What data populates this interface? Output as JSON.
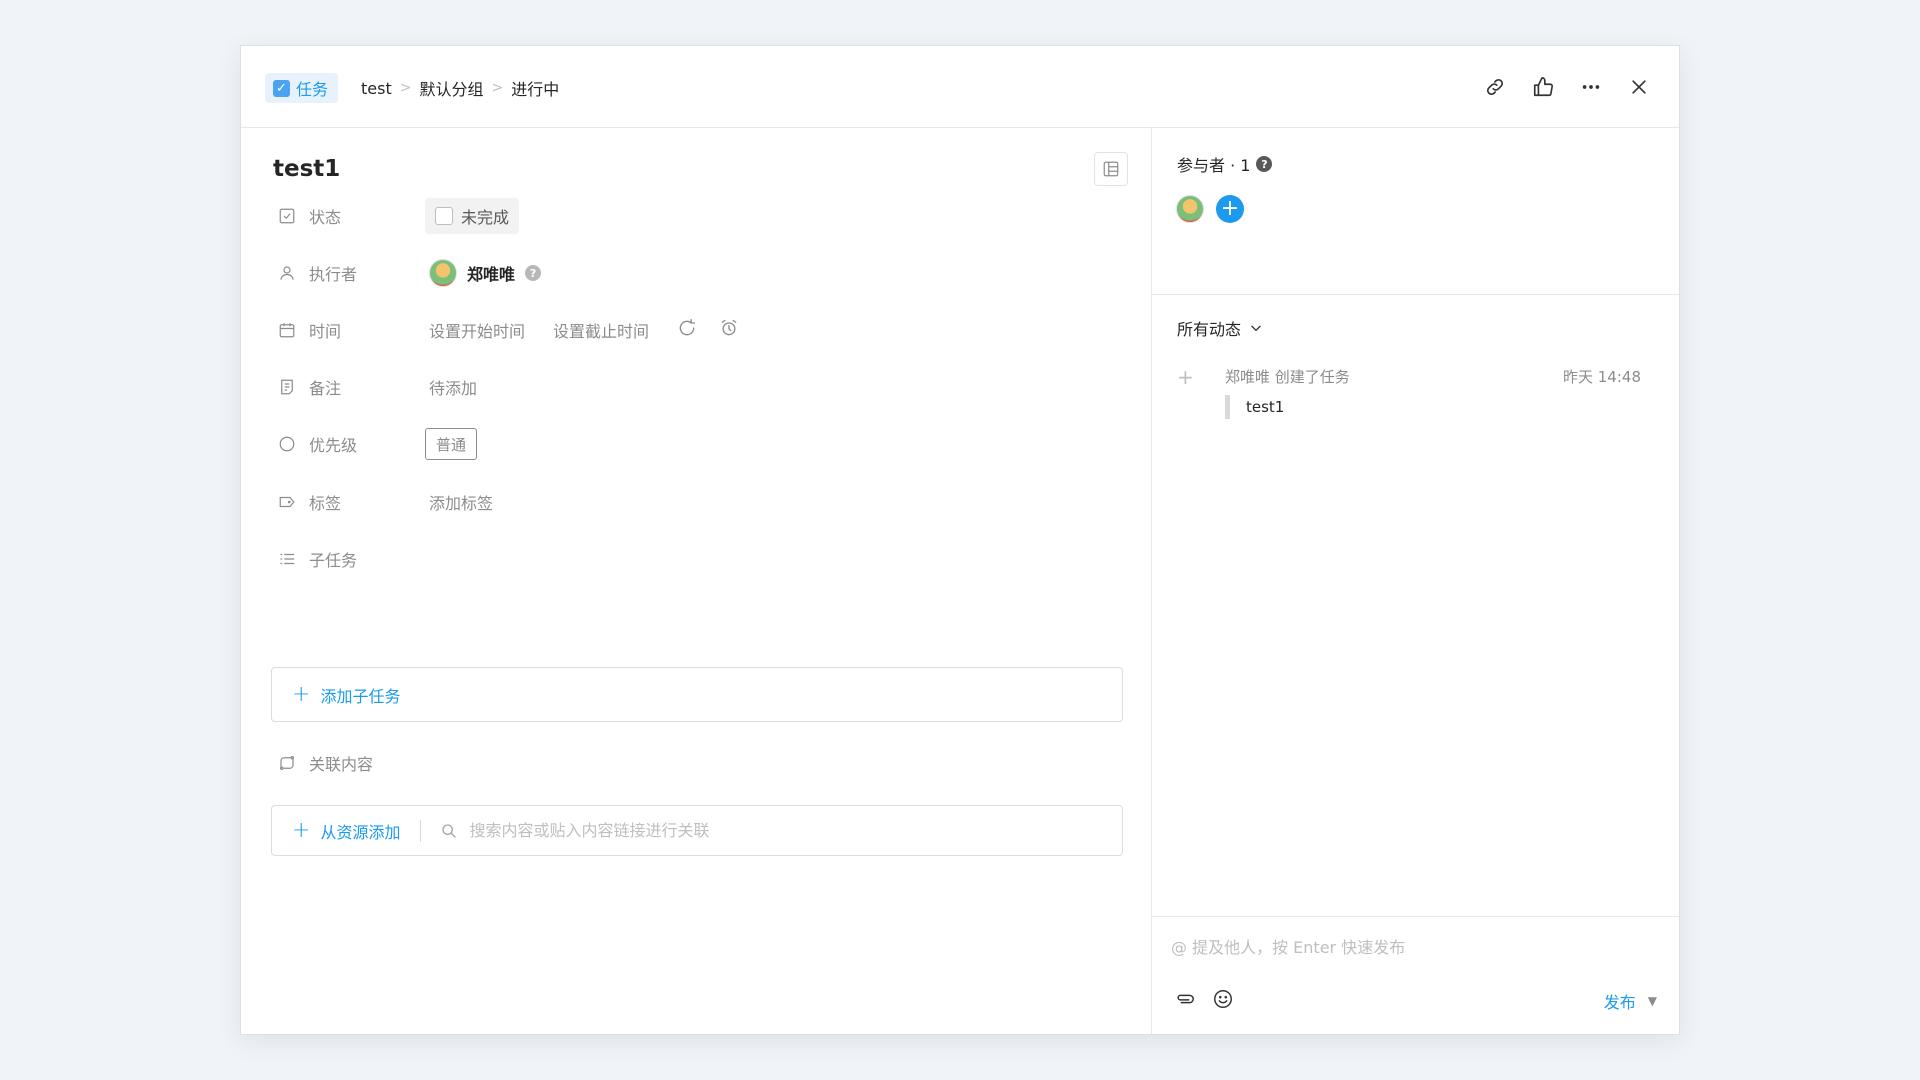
{
  "header": {
    "type_label": "任务",
    "breadcrumbs": [
      "test",
      "默认分组",
      "进行中"
    ]
  },
  "task": {
    "title": "test1",
    "fields": {
      "status": {
        "label": "状态",
        "value": "未完成"
      },
      "executor": {
        "label": "执行者",
        "value": "郑唯唯"
      },
      "time": {
        "label": "时间",
        "start": "设置开始时间",
        "due": "设置截止时间"
      },
      "note": {
        "label": "备注",
        "value": "待添加"
      },
      "priority": {
        "label": "优先级",
        "value": "普通"
      },
      "tags": {
        "label": "标签",
        "value": "添加标签"
      },
      "subtasks": {
        "label": "子任务"
      }
    },
    "add_subtask_label": "添加子任务",
    "related": {
      "label": "关联内容",
      "add_label": "从资源添加",
      "search_placeholder": "搜索内容或贴入内容链接进行关联"
    }
  },
  "sidebar": {
    "participants_label": "参与者 · 1",
    "activity_filter": "所有动态",
    "activities": [
      {
        "text": "郑唯唯 创建了任务",
        "time": "昨天 14:48",
        "quote": "test1"
      }
    ],
    "composer": {
      "placeholder": "@ 提及他人，按 Enter 快速发布",
      "publish_label": "发布"
    }
  },
  "colors": {
    "accent": "#1b9aee",
    "muted": "#8c8c8c"
  }
}
